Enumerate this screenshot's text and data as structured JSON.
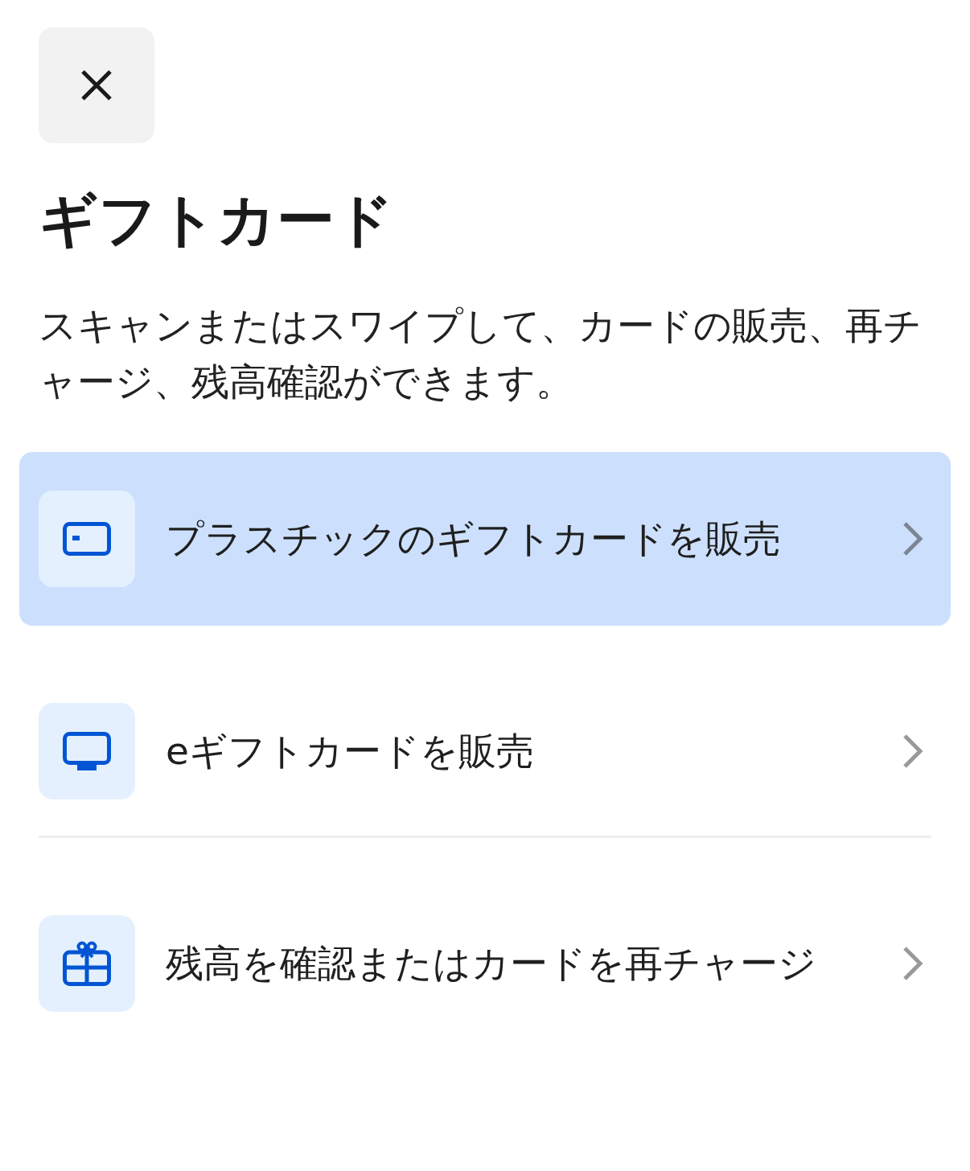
{
  "title": "ギフトカード",
  "description": "スキャンまたはスワイプして、カードの販売、再チャージ、残高確認ができます。",
  "items": [
    {
      "kind": "card",
      "label": "プラスチックのギフトカードを販売",
      "selected": true
    },
    {
      "kind": "monitor",
      "label": "eギフトカードを販売",
      "selected": false
    },
    {
      "kind": "gift",
      "label": "残高を確認またはカードを再チャージ",
      "selected": false
    }
  ]
}
